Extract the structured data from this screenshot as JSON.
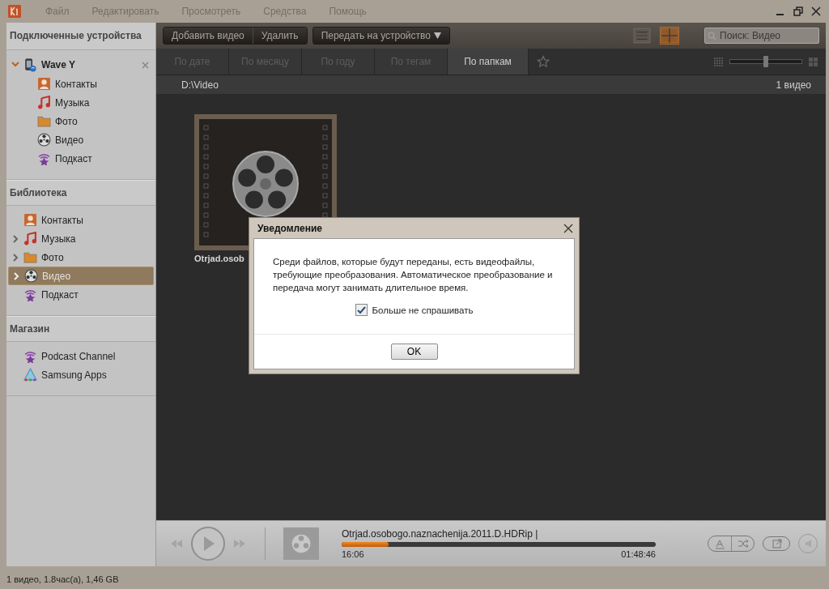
{
  "menu": [
    "Файл",
    "Редактировать",
    "Просмотреть",
    "Средства",
    "Помощь"
  ],
  "sidebar": {
    "sections": [
      {
        "title": "Подключенные устройства",
        "device": {
          "name": "Wave Y",
          "expanded": true,
          "items": [
            {
              "kind": "contacts",
              "label": "Контакты"
            },
            {
              "kind": "music",
              "label": "Музыка"
            },
            {
              "kind": "photo",
              "label": "Фото"
            },
            {
              "kind": "video",
              "label": "Видео"
            },
            {
              "kind": "podcast",
              "label": "Подкаст"
            }
          ]
        }
      },
      {
        "title": "Библиотека",
        "items": [
          {
            "kind": "contacts",
            "label": "Контакты",
            "expandable": false,
            "selected": false
          },
          {
            "kind": "music",
            "label": "Музыка",
            "expandable": true,
            "selected": false
          },
          {
            "kind": "photo",
            "label": "Фото",
            "expandable": true,
            "selected": false
          },
          {
            "kind": "video",
            "label": "Видео",
            "expandable": true,
            "selected": true
          },
          {
            "kind": "podcast",
            "label": "Подкаст",
            "expandable": false,
            "selected": false
          }
        ]
      },
      {
        "title": "Магазин",
        "items": [
          {
            "kind": "podcast",
            "label": "Podcast Channel",
            "expandable": false,
            "selected": false
          },
          {
            "kind": "apps",
            "label": "Samsung Apps",
            "expandable": false,
            "selected": false
          }
        ]
      }
    ]
  },
  "toolbar": {
    "buttons": [
      "Добавить видео",
      "Удалить"
    ],
    "transfer": "Передать на устройство",
    "views": [
      {
        "kind": "list",
        "selected": false
      },
      {
        "kind": "grid",
        "selected": true
      }
    ],
    "search": {
      "placeholder": "Поиск: Видео"
    }
  },
  "tabs": [
    {
      "label": "По дате",
      "selected": false
    },
    {
      "label": "По месяцу",
      "selected": false
    },
    {
      "label": "По году",
      "selected": false
    },
    {
      "label": "По тегам",
      "selected": false
    },
    {
      "label": "По папкам",
      "selected": true
    }
  ],
  "zoom": {
    "level": 0.5
  },
  "path": "D:\\Video",
  "count": "1 видео",
  "items": [
    {
      "caption": "Otrjad.osob"
    }
  ],
  "dialog": {
    "title": "Уведомление",
    "message": "Среди файлов, которые будут переданы, есть видеофайлы, требующие преобразования. Автоматическое преобразование и передача могут занимать длительное время.",
    "checkbox": {
      "label": "Больше не спрашивать",
      "checked": true
    },
    "button": "OK"
  },
  "player": {
    "track": "Otrjad.osobogo.naznachenija.2011.D.HDRip |",
    "level": 0.15,
    "elapsed": "16:06",
    "total": "01:48:46"
  },
  "status_bar": "1 видео, 1.8час(а), 1,46 GB"
}
